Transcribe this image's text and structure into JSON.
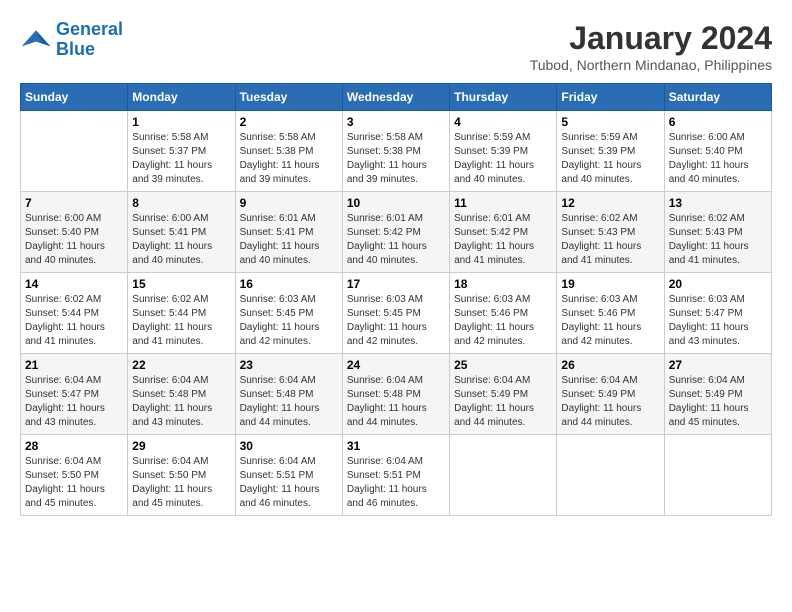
{
  "header": {
    "logo_line1": "General",
    "logo_line2": "Blue",
    "month": "January 2024",
    "location": "Tubod, Northern Mindanao, Philippines"
  },
  "weekdays": [
    "Sunday",
    "Monday",
    "Tuesday",
    "Wednesday",
    "Thursday",
    "Friday",
    "Saturday"
  ],
  "weeks": [
    [
      {
        "day": "",
        "info": ""
      },
      {
        "day": "1",
        "info": "Sunrise: 5:58 AM\nSunset: 5:37 PM\nDaylight: 11 hours\nand 39 minutes."
      },
      {
        "day": "2",
        "info": "Sunrise: 5:58 AM\nSunset: 5:38 PM\nDaylight: 11 hours\nand 39 minutes."
      },
      {
        "day": "3",
        "info": "Sunrise: 5:58 AM\nSunset: 5:38 PM\nDaylight: 11 hours\nand 39 minutes."
      },
      {
        "day": "4",
        "info": "Sunrise: 5:59 AM\nSunset: 5:39 PM\nDaylight: 11 hours\nand 40 minutes."
      },
      {
        "day": "5",
        "info": "Sunrise: 5:59 AM\nSunset: 5:39 PM\nDaylight: 11 hours\nand 40 minutes."
      },
      {
        "day": "6",
        "info": "Sunrise: 6:00 AM\nSunset: 5:40 PM\nDaylight: 11 hours\nand 40 minutes."
      }
    ],
    [
      {
        "day": "7",
        "info": "Sunrise: 6:00 AM\nSunset: 5:40 PM\nDaylight: 11 hours\nand 40 minutes."
      },
      {
        "day": "8",
        "info": "Sunrise: 6:00 AM\nSunset: 5:41 PM\nDaylight: 11 hours\nand 40 minutes."
      },
      {
        "day": "9",
        "info": "Sunrise: 6:01 AM\nSunset: 5:41 PM\nDaylight: 11 hours\nand 40 minutes."
      },
      {
        "day": "10",
        "info": "Sunrise: 6:01 AM\nSunset: 5:42 PM\nDaylight: 11 hours\nand 40 minutes."
      },
      {
        "day": "11",
        "info": "Sunrise: 6:01 AM\nSunset: 5:42 PM\nDaylight: 11 hours\nand 41 minutes."
      },
      {
        "day": "12",
        "info": "Sunrise: 6:02 AM\nSunset: 5:43 PM\nDaylight: 11 hours\nand 41 minutes."
      },
      {
        "day": "13",
        "info": "Sunrise: 6:02 AM\nSunset: 5:43 PM\nDaylight: 11 hours\nand 41 minutes."
      }
    ],
    [
      {
        "day": "14",
        "info": "Sunrise: 6:02 AM\nSunset: 5:44 PM\nDaylight: 11 hours\nand 41 minutes."
      },
      {
        "day": "15",
        "info": "Sunrise: 6:02 AM\nSunset: 5:44 PM\nDaylight: 11 hours\nand 41 minutes."
      },
      {
        "day": "16",
        "info": "Sunrise: 6:03 AM\nSunset: 5:45 PM\nDaylight: 11 hours\nand 42 minutes."
      },
      {
        "day": "17",
        "info": "Sunrise: 6:03 AM\nSunset: 5:45 PM\nDaylight: 11 hours\nand 42 minutes."
      },
      {
        "day": "18",
        "info": "Sunrise: 6:03 AM\nSunset: 5:46 PM\nDaylight: 11 hours\nand 42 minutes."
      },
      {
        "day": "19",
        "info": "Sunrise: 6:03 AM\nSunset: 5:46 PM\nDaylight: 11 hours\nand 42 minutes."
      },
      {
        "day": "20",
        "info": "Sunrise: 6:03 AM\nSunset: 5:47 PM\nDaylight: 11 hours\nand 43 minutes."
      }
    ],
    [
      {
        "day": "21",
        "info": "Sunrise: 6:04 AM\nSunset: 5:47 PM\nDaylight: 11 hours\nand 43 minutes."
      },
      {
        "day": "22",
        "info": "Sunrise: 6:04 AM\nSunset: 5:48 PM\nDaylight: 11 hours\nand 43 minutes."
      },
      {
        "day": "23",
        "info": "Sunrise: 6:04 AM\nSunset: 5:48 PM\nDaylight: 11 hours\nand 44 minutes."
      },
      {
        "day": "24",
        "info": "Sunrise: 6:04 AM\nSunset: 5:48 PM\nDaylight: 11 hours\nand 44 minutes."
      },
      {
        "day": "25",
        "info": "Sunrise: 6:04 AM\nSunset: 5:49 PM\nDaylight: 11 hours\nand 44 minutes."
      },
      {
        "day": "26",
        "info": "Sunrise: 6:04 AM\nSunset: 5:49 PM\nDaylight: 11 hours\nand 44 minutes."
      },
      {
        "day": "27",
        "info": "Sunrise: 6:04 AM\nSunset: 5:49 PM\nDaylight: 11 hours\nand 45 minutes."
      }
    ],
    [
      {
        "day": "28",
        "info": "Sunrise: 6:04 AM\nSunset: 5:50 PM\nDaylight: 11 hours\nand 45 minutes."
      },
      {
        "day": "29",
        "info": "Sunrise: 6:04 AM\nSunset: 5:50 PM\nDaylight: 11 hours\nand 45 minutes."
      },
      {
        "day": "30",
        "info": "Sunrise: 6:04 AM\nSunset: 5:51 PM\nDaylight: 11 hours\nand 46 minutes."
      },
      {
        "day": "31",
        "info": "Sunrise: 6:04 AM\nSunset: 5:51 PM\nDaylight: 11 hours\nand 46 minutes."
      },
      {
        "day": "",
        "info": ""
      },
      {
        "day": "",
        "info": ""
      },
      {
        "day": "",
        "info": ""
      }
    ]
  ]
}
